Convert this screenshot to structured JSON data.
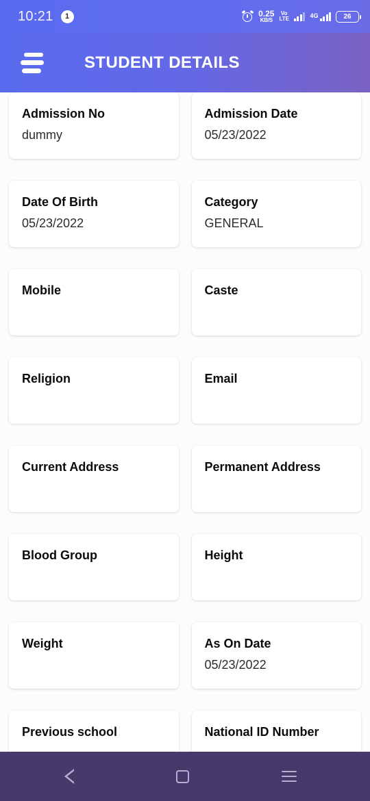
{
  "status_bar": {
    "time": "10:21",
    "notification_count": "1",
    "alarm_icon": "alarm-clock-icon",
    "net_speed_value": "0.25",
    "net_speed_unit": "KB/S",
    "volte_line1": "Vo",
    "volte_line2": "LTE",
    "network_type": "4G",
    "battery_level": "26"
  },
  "app_bar": {
    "menu_icon": "hamburger-menu-icon",
    "title": "STUDENT DETAILS",
    "gradient_start": "#5a6bef",
    "gradient_end": "#7a63c4"
  },
  "details": {
    "rows": [
      [
        {
          "label": "Admission No",
          "value": "dummy"
        },
        {
          "label": "Admission Date",
          "value": "05/23/2022"
        }
      ],
      [
        {
          "label": "Date Of Birth",
          "value": "05/23/2022"
        },
        {
          "label": "Category",
          "value": "GENERAL"
        }
      ],
      [
        {
          "label": "Mobile",
          "value": ""
        },
        {
          "label": "Caste",
          "value": ""
        }
      ],
      [
        {
          "label": "Religion",
          "value": ""
        },
        {
          "label": "Email",
          "value": ""
        }
      ],
      [
        {
          "label": "Current Address",
          "value": ""
        },
        {
          "label": "Permanent Address",
          "value": ""
        }
      ],
      [
        {
          "label": "Blood Group",
          "value": ""
        },
        {
          "label": "Height",
          "value": ""
        }
      ],
      [
        {
          "label": "Weight",
          "value": ""
        },
        {
          "label": "As On Date",
          "value": "05/23/2022"
        }
      ],
      [
        {
          "label": "Previous school",
          "value": ""
        },
        {
          "label": "National ID Number",
          "value": ""
        }
      ]
    ]
  },
  "nav_bar": {
    "back_icon": "back-triangle-icon",
    "home_icon": "home-square-icon",
    "recents_icon": "recents-menu-icon",
    "background": "#473a6b"
  }
}
